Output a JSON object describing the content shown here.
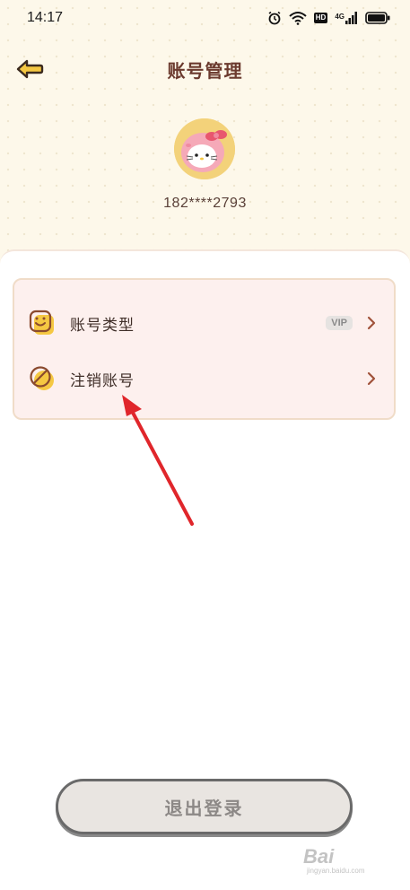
{
  "status_bar": {
    "time": "14:17",
    "icons": [
      "alarm-icon",
      "wifi-icon",
      "hd-icon",
      "signal-4g-icon",
      "battery-icon"
    ],
    "hd_label": "HD",
    "network_label": "4G"
  },
  "nav": {
    "back_icon": "back-arrow-icon",
    "title": "账号管理"
  },
  "profile": {
    "avatar_icon": "hello-kitty-avatar",
    "phone": "182****2793"
  },
  "menu": {
    "items": [
      {
        "icon": "smiley-face-icon",
        "label": "账号类型",
        "badge": "VIP",
        "chevron": "chevron-right-icon"
      },
      {
        "icon": "prohibited-circle-icon",
        "label": "注销账号",
        "chevron": "chevron-right-icon"
      }
    ]
  },
  "annotation": {
    "icon": "red-pointer-arrow",
    "color": "#e0262b"
  },
  "footer": {
    "logout_label": "退出登录"
  },
  "watermark": {
    "brand": "Bai",
    "sub": "jingyan.baidu.com"
  },
  "colors": {
    "header_bg": "#fdf8ea",
    "title": "#6b3a2e",
    "card_bg": "#fdf0ee",
    "card_border": "#f0dcc8",
    "accent_yellow": "#f5c842",
    "chevron": "#a0523a"
  }
}
